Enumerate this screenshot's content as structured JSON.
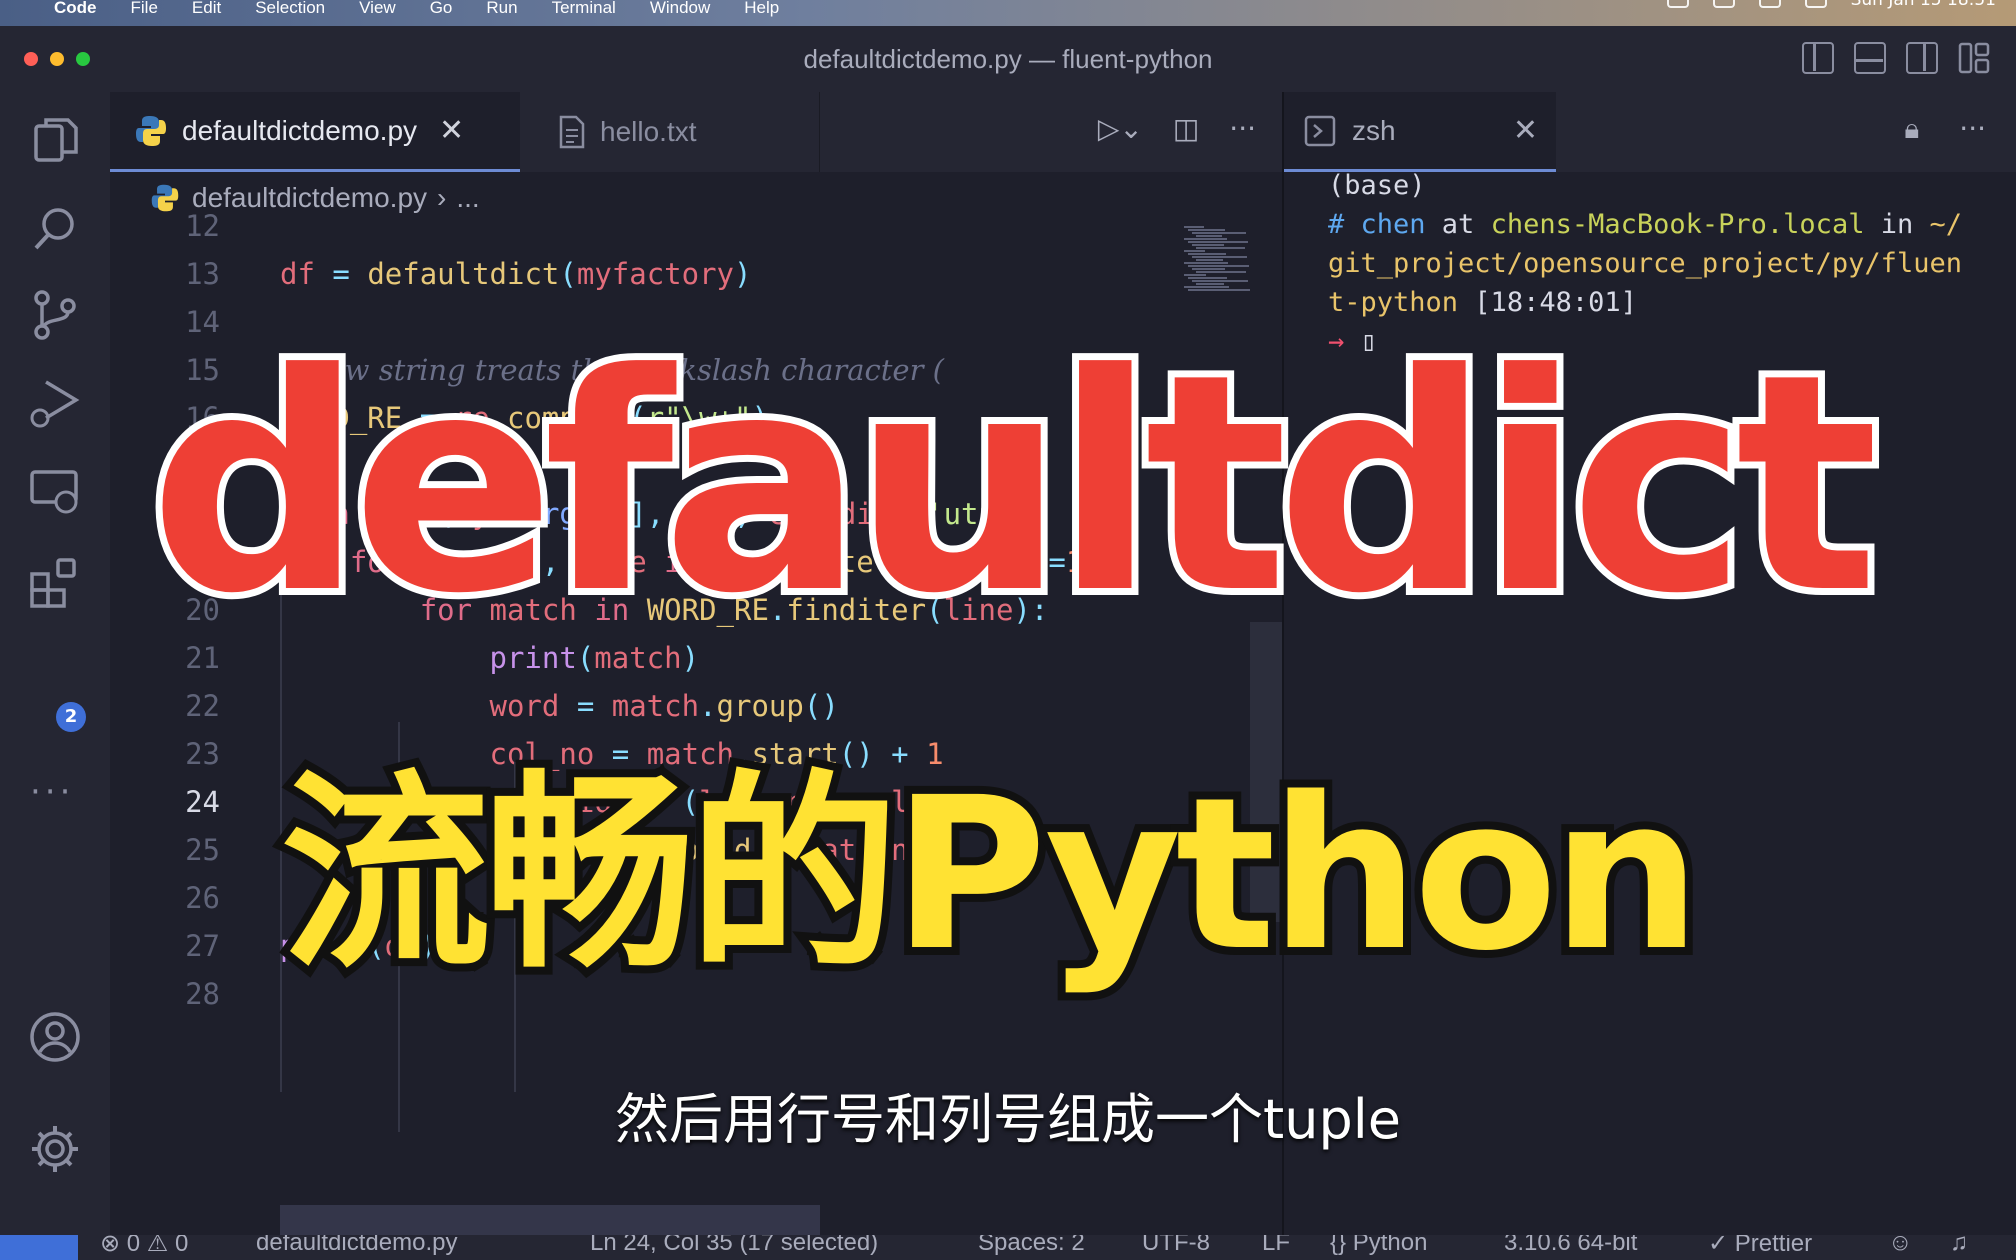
{
  "menubar": {
    "items": [
      "Code",
      "File",
      "Edit",
      "Selection",
      "View",
      "Go",
      "Run",
      "Terminal",
      "Window",
      "Help"
    ],
    "clock": "Sun Jan 15 18:51"
  },
  "window": {
    "title": "defaultdictdemo.py — fluent-python"
  },
  "activity": {
    "extensions_badge": "2"
  },
  "editor": {
    "tabs": [
      {
        "label": "defaultdictdemo.py",
        "active": true
      },
      {
        "label": "hello.txt",
        "active": false
      }
    ],
    "breadcrumb": {
      "file": "defaultdictdemo.py",
      "more": "..."
    },
    "lines": [
      {
        "n": "12",
        "t": ""
      },
      {
        "n": "13",
        "t": "df = defaultdict(myfactory)"
      },
      {
        "n": "14",
        "t": ""
      },
      {
        "n": "15",
        "t": "# raw string treats the backslash character ("
      },
      {
        "n": "16",
        "t": "WORD_RE = re.compile(r\"\\w+\")"
      },
      {
        "n": "17",
        "t": ""
      },
      {
        "n": "18",
        "t": "with open(sys.argv[1], 'r', encoding='utf-8"
      },
      {
        "n": "19",
        "t": "    for line_no, line in enumerate(fp, start=1)"
      },
      {
        "n": "20",
        "t": "        for match in WORD_RE.finditer(line):"
      },
      {
        "n": "21",
        "t": "            print(match)"
      },
      {
        "n": "22",
        "t": "            word = match.group()"
      },
      {
        "n": "23",
        "t": "            col_no = match.start() + 1"
      },
      {
        "n": "24",
        "t": "            location = (line_no, col_no)"
      },
      {
        "n": "25",
        "t": "            df[word].append(location)"
      },
      {
        "n": "26",
        "t": ""
      },
      {
        "n": "27",
        "t": "print(df)"
      },
      {
        "n": "28",
        "t": ""
      }
    ],
    "current_line": "24"
  },
  "terminal": {
    "tab_label": "zsh",
    "lines": [
      {
        "seg": [
          {
            "c": "",
            "t": "(base)"
          }
        ]
      },
      {
        "seg": [
          {
            "c": "t-blue",
            "t": "# "
          },
          {
            "c": "t-blue",
            "t": "chen"
          },
          {
            "c": "",
            "t": " at "
          },
          {
            "c": "t-green",
            "t": "chens-MacBook-Pro.local"
          },
          {
            "c": "",
            "t": " in "
          },
          {
            "c": "t-yellow",
            "t": "~/"
          }
        ]
      },
      {
        "seg": [
          {
            "c": "t-yellow",
            "t": "git_project/opensource_project/py/fluen"
          }
        ]
      },
      {
        "seg": [
          {
            "c": "t-yellow",
            "t": "t-python"
          },
          {
            "c": "",
            "t": " [18:48:01]"
          }
        ]
      },
      {
        "seg": [
          {
            "c": "t-red",
            "t": "→ "
          },
          {
            "c": "",
            "t": "▯"
          }
        ]
      }
    ]
  },
  "statusbar": {
    "problems": "⊗ 0 ⚠ 0",
    "file": "defaultdictdemo.py",
    "cursor": "Ln 24, Col 35 (17 selected)",
    "spaces": "Spaces: 2",
    "encoding": "UTF-8",
    "eol": "LF",
    "language": "{} Python",
    "interpreter": "3.10.6 64-bit",
    "formatter": "✓ Prettier"
  },
  "overlay": {
    "title": "defaultdict",
    "subtitle": "流畅的Python",
    "caption": "然后用行号和列号组成一个tuple"
  },
  "colors": {
    "editor_bg": "#1e1f2b",
    "title_red": "#ee3f35",
    "title_yellow": "#ffe233",
    "accent_blue": "#3f6fd8"
  }
}
